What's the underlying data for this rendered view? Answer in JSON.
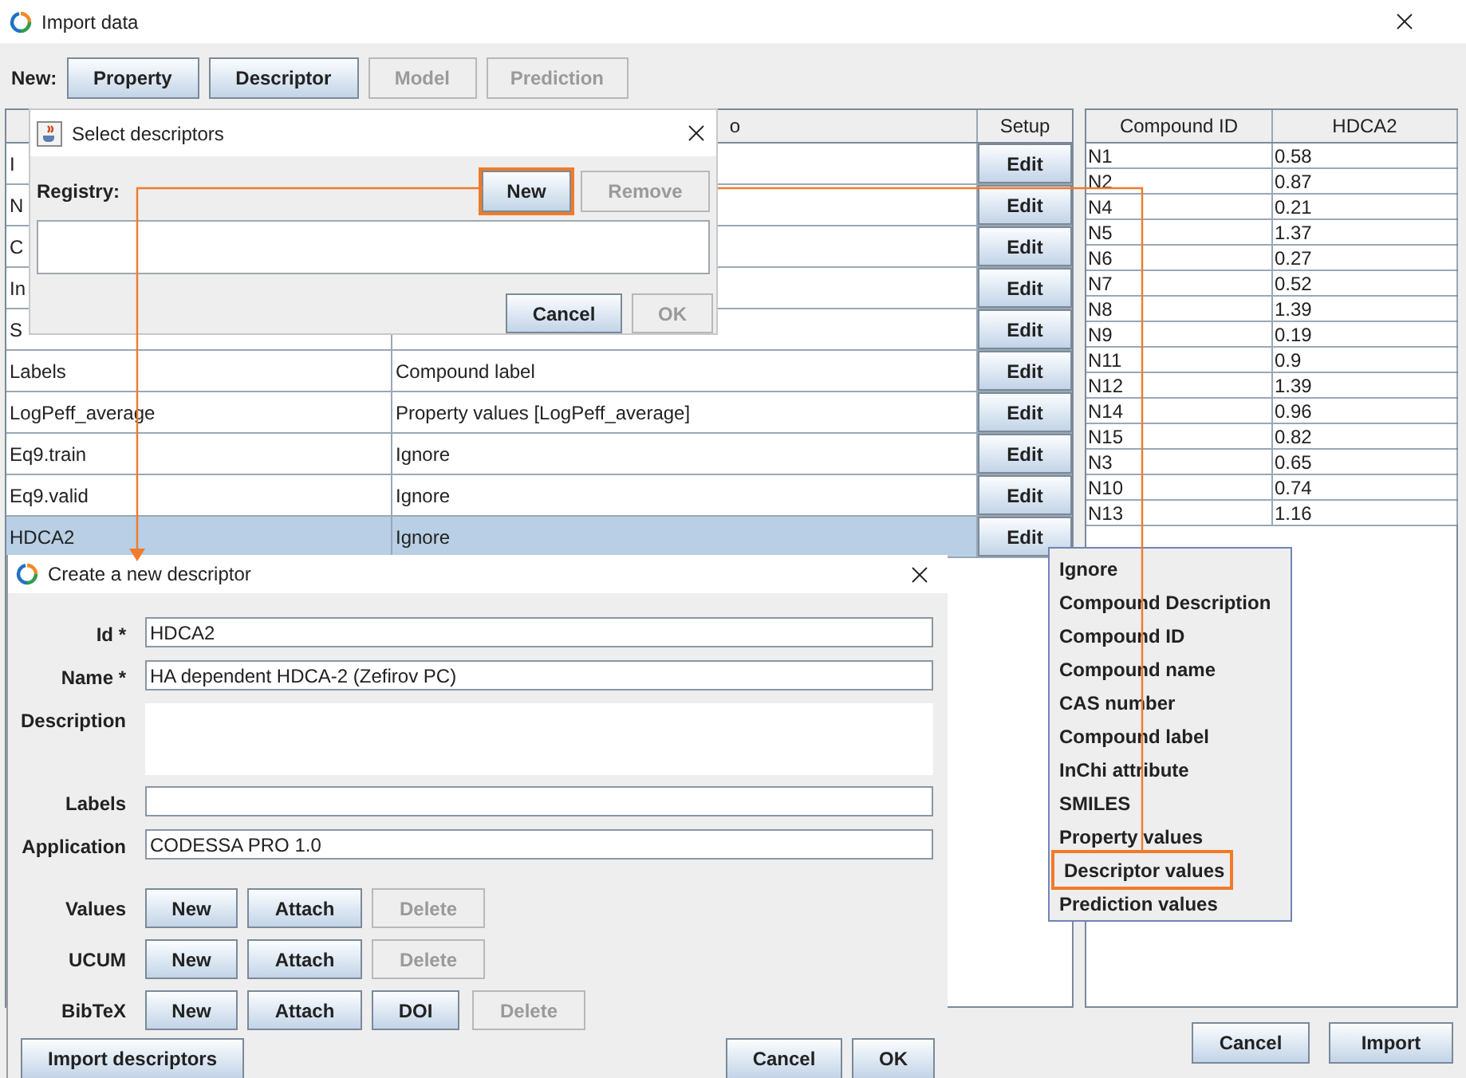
{
  "window": {
    "title": "Import data"
  },
  "toolbar": {
    "label": "New:",
    "buttons": [
      {
        "label": "Property",
        "disabled": false
      },
      {
        "label": "Descriptor",
        "disabled": false
      },
      {
        "label": "Model",
        "disabled": true
      },
      {
        "label": "Prediction",
        "disabled": true
      }
    ]
  },
  "table": {
    "headers": {
      "column_2": "o",
      "setup": "Setup"
    },
    "rows": [
      {
        "name": "I",
        "action": "Edit",
        "selected": false
      },
      {
        "name": "N",
        "action": "Edit",
        "selected": false
      },
      {
        "name": "C",
        "action": "Edit",
        "selected": false
      },
      {
        "name": "In",
        "action": "Edit",
        "selected": false
      },
      {
        "name": "S",
        "action": "Edit",
        "selected": false
      },
      {
        "name": "Labels",
        "mapping": "Compound label",
        "action": "Edit",
        "selected": false
      },
      {
        "name": "LogPeff_average",
        "mapping": "Property values [LogPeff_average]",
        "action": "Edit",
        "selected": false
      },
      {
        "name": "Eq9.train",
        "mapping": "Ignore",
        "action": "Edit",
        "selected": false
      },
      {
        "name": "Eq9.valid",
        "mapping": "Ignore",
        "action": "Edit",
        "selected": false
      },
      {
        "name": "HDCA2",
        "mapping": "Ignore",
        "action": "Edit",
        "selected": true
      }
    ]
  },
  "preview": {
    "columns": [
      "Compound ID",
      "HDCA2"
    ],
    "rows": [
      [
        "N1",
        "0.58"
      ],
      [
        "N2",
        "0.87"
      ],
      [
        "N4",
        "0.21"
      ],
      [
        "N5",
        "1.37"
      ],
      [
        "N6",
        "0.27"
      ],
      [
        "N7",
        "0.52"
      ],
      [
        "N8",
        "1.39"
      ],
      [
        "N9",
        "0.19"
      ],
      [
        "N11",
        "0.9"
      ],
      [
        "N12",
        "1.39"
      ],
      [
        "N14",
        "0.96"
      ],
      [
        "N15",
        "0.82"
      ],
      [
        "N3",
        "0.65"
      ],
      [
        "N10",
        "0.74"
      ],
      [
        "N13",
        "1.16"
      ]
    ]
  },
  "footer": {
    "buttons": [
      {
        "label": "Cancel",
        "disabled": false
      },
      {
        "label": "Import",
        "disabled": false
      }
    ]
  },
  "select_dialog": {
    "title": "Select descriptors",
    "registry_label": "Registry:",
    "buttons": [
      {
        "label": "New",
        "disabled": false,
        "highlighted": true
      },
      {
        "label": "Remove",
        "disabled": true,
        "highlighted": false
      }
    ],
    "footer": [
      {
        "label": "Cancel",
        "disabled": false
      },
      {
        "label": "OK",
        "disabled": true
      }
    ]
  },
  "create_dialog": {
    "title": "Create a new descriptor",
    "fields": [
      {
        "label": "Id *",
        "value": "HDCA2",
        "kind": "line"
      },
      {
        "label": "Name *",
        "value": "HA dependent HDCA-2 (Zefirov PC)",
        "kind": "line"
      },
      {
        "label": "Description",
        "kind": "area"
      },
      {
        "label": "Labels",
        "kind": "line"
      },
      {
        "label": "Application",
        "value": "CODESSA PRO 1.0",
        "kind": "line"
      }
    ],
    "attachments": [
      {
        "label": "Values",
        "buttons": [
          {
            "label": "New",
            "disabled": false
          },
          {
            "label": "Attach",
            "disabled": false
          },
          {
            "label": "Delete",
            "disabled": true
          }
        ]
      },
      {
        "label": "UCUM",
        "buttons": [
          {
            "label": "New",
            "disabled": false
          },
          {
            "label": "Attach",
            "disabled": false
          },
          {
            "label": "Delete",
            "disabled": true
          }
        ]
      },
      {
        "label": "BibTeX",
        "buttons": [
          {
            "label": "New",
            "disabled": false
          },
          {
            "label": "Attach",
            "disabled": false
          },
          {
            "label": "DOI",
            "disabled": false
          },
          {
            "label": "Delete",
            "disabled": true
          }
        ]
      }
    ],
    "footer_left": {
      "label": "Import descriptors",
      "disabled": false
    },
    "footer_right": [
      {
        "label": "Cancel",
        "disabled": false
      },
      {
        "label": "OK",
        "disabled": false
      }
    ]
  },
  "menu": {
    "items": [
      {
        "label": "Ignore",
        "highlighted": false
      },
      {
        "label": "Compound Description",
        "highlighted": false
      },
      {
        "label": "Compound ID",
        "highlighted": false
      },
      {
        "label": "Compound name",
        "highlighted": false
      },
      {
        "label": "CAS number",
        "highlighted": false
      },
      {
        "label": "Compound label",
        "highlighted": false
      },
      {
        "label": "InChi attribute",
        "highlighted": false
      },
      {
        "label": "SMILES",
        "highlighted": false
      },
      {
        "label": "Property values",
        "highlighted": false
      },
      {
        "label": "Descriptor values",
        "highlighted": true
      },
      {
        "label": "Prediction values",
        "highlighted": false
      }
    ]
  }
}
